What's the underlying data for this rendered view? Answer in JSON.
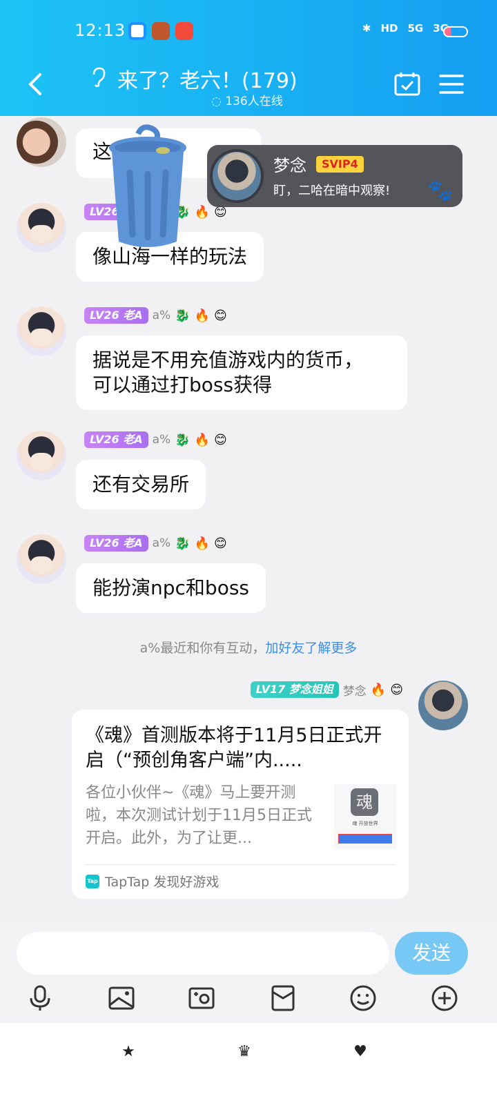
{
  "status_bar": {
    "time": "12:13",
    "network_labels": [
      "HD",
      "5G",
      "3G"
    ]
  },
  "header": {
    "title": "来了？老六！(179)",
    "online": "136人在线"
  },
  "toast": {
    "name": "梦念",
    "badge": "SVIP4",
    "message": "盯，二哈在暗中观察!"
  },
  "messages": [
    {
      "text": "这...火的",
      "partial": true
    },
    {
      "level": "LV26 老A",
      "nick": "a%",
      "text": "像山海一样的玩法"
    },
    {
      "level": "LV26 老A",
      "nick": "a%",
      "line1": "据说是不用充值游戏内的货币，",
      "line2": "可以通过打boss获得"
    },
    {
      "level": "LV26 老A",
      "nick": "a%",
      "text": "还有交易所"
    },
    {
      "level": "LV26 老A",
      "nick": "a%",
      "text": "能扮演npc和boss"
    }
  ],
  "hint": {
    "text": "a%最近和你有互动，",
    "link": "加好友了解更多"
  },
  "own": {
    "level": "LV17 梦念姐姐",
    "nick": "梦念"
  },
  "card": {
    "title": "《魂》首测版本将于11月5日正式开启（“预创角客户端”内.....",
    "desc": "各位小伙伴~《魂》马上要开测啦，本次测试计划于11月5日正式开启。此外，为了让更...",
    "thumb_logo": "魂",
    "thumb_text": "魂 开放世界",
    "source": "TapTap 发现好游戏",
    "source_icon": "Tap"
  },
  "input": {
    "placeholder": "",
    "send_label": "发送"
  }
}
